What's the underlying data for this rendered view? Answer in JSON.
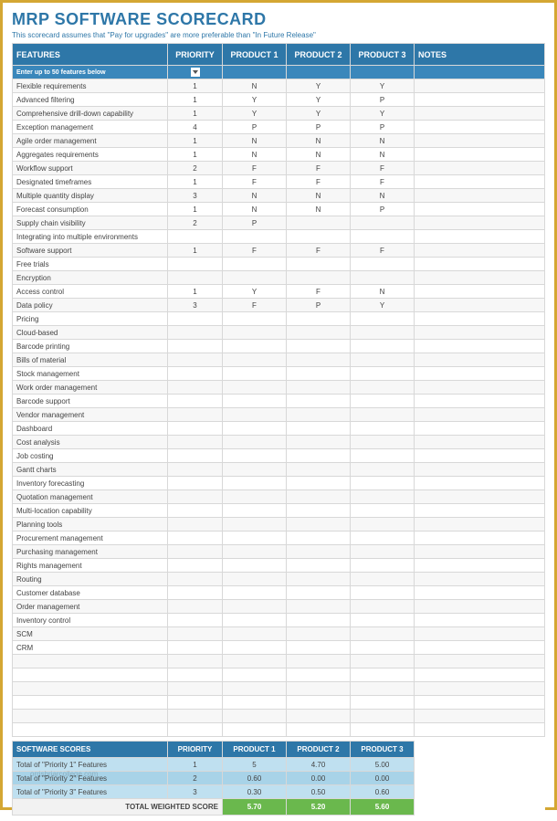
{
  "title": "MRP SOFTWARE SCORECARD",
  "subtitle": "This scorecard assumes that \"Pay for upgrades\" are more preferable than \"In Future Release\"",
  "headers": {
    "features": "FEATURES",
    "priority": "PRIORITY",
    "p1": "PRODUCT 1",
    "p2": "PRODUCT 2",
    "p3": "PRODUCT 3",
    "notes": "NOTES"
  },
  "subhead": "Enter up to 50 features below",
  "rows": [
    {
      "f": "Flexible requirements",
      "prio": "1",
      "p1": "N",
      "p2": "Y",
      "p3": "Y"
    },
    {
      "f": "Advanced filtering",
      "prio": "1",
      "p1": "Y",
      "p2": "Y",
      "p3": "P"
    },
    {
      "f": "Comprehensive drill-down capability",
      "prio": "1",
      "p1": "Y",
      "p2": "Y",
      "p3": "Y"
    },
    {
      "f": "Exception management",
      "prio": "4",
      "p1": "P",
      "p2": "P",
      "p3": "P"
    },
    {
      "f": "Agile order management",
      "prio": "1",
      "p1": "N",
      "p2": "N",
      "p3": "N"
    },
    {
      "f": "Aggregates requirements",
      "prio": "1",
      "p1": "N",
      "p2": "N",
      "p3": "N"
    },
    {
      "f": "Workflow support",
      "prio": "2",
      "p1": "F",
      "p2": "F",
      "p3": "F"
    },
    {
      "f": "Designated timeframes",
      "prio": "1",
      "p1": "F",
      "p2": "F",
      "p3": "F"
    },
    {
      "f": "Multiple quantity display",
      "prio": "3",
      "p1": "N",
      "p2": "N",
      "p3": "N"
    },
    {
      "f": "Forecast consumption",
      "prio": "1",
      "p1": "N",
      "p2": "N",
      "p3": "P"
    },
    {
      "f": "Supply chain visibility",
      "prio": "2",
      "p1": "P",
      "p2": "",
      "p3": ""
    },
    {
      "f": "Integrating into multiple environments",
      "prio": "",
      "p1": "",
      "p2": "",
      "p3": ""
    },
    {
      "f": "Software support",
      "prio": "1",
      "p1": "F",
      "p2": "F",
      "p3": "F"
    },
    {
      "f": "Free trials",
      "prio": "",
      "p1": "",
      "p2": "",
      "p3": ""
    },
    {
      "f": "Encryption",
      "prio": "",
      "p1": "",
      "p2": "",
      "p3": ""
    },
    {
      "f": "Access control",
      "prio": "1",
      "p1": "Y",
      "p2": "F",
      "p3": "N"
    },
    {
      "f": "Data policy",
      "prio": "3",
      "p1": "F",
      "p2": "P",
      "p3": "Y"
    },
    {
      "f": "Pricing",
      "prio": "",
      "p1": "",
      "p2": "",
      "p3": ""
    },
    {
      "f": "Cloud-based",
      "prio": "",
      "p1": "",
      "p2": "",
      "p3": ""
    },
    {
      "f": "Barcode printing",
      "prio": "",
      "p1": "",
      "p2": "",
      "p3": ""
    },
    {
      "f": "Bills of material",
      "prio": "",
      "p1": "",
      "p2": "",
      "p3": ""
    },
    {
      "f": "Stock management",
      "prio": "",
      "p1": "",
      "p2": "",
      "p3": ""
    },
    {
      "f": "Work order management",
      "prio": "",
      "p1": "",
      "p2": "",
      "p3": ""
    },
    {
      "f": "Barcode support",
      "prio": "",
      "p1": "",
      "p2": "",
      "p3": ""
    },
    {
      "f": "Vendor management",
      "prio": "",
      "p1": "",
      "p2": "",
      "p3": ""
    },
    {
      "f": "Dashboard",
      "prio": "",
      "p1": "",
      "p2": "",
      "p3": ""
    },
    {
      "f": "Cost analysis",
      "prio": "",
      "p1": "",
      "p2": "",
      "p3": ""
    },
    {
      "f": "Job costing",
      "prio": "",
      "p1": "",
      "p2": "",
      "p3": ""
    },
    {
      "f": "Gantt charts",
      "prio": "",
      "p1": "",
      "p2": "",
      "p3": ""
    },
    {
      "f": "Inventory forecasting",
      "prio": "",
      "p1": "",
      "p2": "",
      "p3": ""
    },
    {
      "f": "Quotation management",
      "prio": "",
      "p1": "",
      "p2": "",
      "p3": ""
    },
    {
      "f": "Multi-location capability",
      "prio": "",
      "p1": "",
      "p2": "",
      "p3": ""
    },
    {
      "f": "Planning tools",
      "prio": "",
      "p1": "",
      "p2": "",
      "p3": ""
    },
    {
      "f": "Procurement management",
      "prio": "",
      "p1": "",
      "p2": "",
      "p3": ""
    },
    {
      "f": "Purchasing management",
      "prio": "",
      "p1": "",
      "p2": "",
      "p3": ""
    },
    {
      "f": "Rights management",
      "prio": "",
      "p1": "",
      "p2": "",
      "p3": ""
    },
    {
      "f": "Routing",
      "prio": "",
      "p1": "",
      "p2": "",
      "p3": ""
    },
    {
      "f": "Customer database",
      "prio": "",
      "p1": "",
      "p2": "",
      "p3": ""
    },
    {
      "f": "Order management",
      "prio": "",
      "p1": "",
      "p2": "",
      "p3": ""
    },
    {
      "f": "Inventory control",
      "prio": "",
      "p1": "",
      "p2": "",
      "p3": ""
    },
    {
      "f": "SCM",
      "prio": "",
      "p1": "",
      "p2": "",
      "p3": ""
    },
    {
      "f": "CRM",
      "prio": "",
      "p1": "",
      "p2": "",
      "p3": ""
    },
    {
      "f": "",
      "prio": "",
      "p1": "",
      "p2": "",
      "p3": ""
    },
    {
      "f": "",
      "prio": "",
      "p1": "",
      "p2": "",
      "p3": ""
    },
    {
      "f": "",
      "prio": "",
      "p1": "",
      "p2": "",
      "p3": ""
    },
    {
      "f": "",
      "prio": "",
      "p1": "",
      "p2": "",
      "p3": ""
    },
    {
      "f": "",
      "prio": "",
      "p1": "",
      "p2": "",
      "p3": ""
    },
    {
      "f": "",
      "prio": "",
      "p1": "",
      "p2": "",
      "p3": ""
    }
  ],
  "scores": {
    "header": "SOFTWARE SCORES",
    "cols": {
      "priority": "PRIORITY",
      "p1": "PRODUCT 1",
      "p2": "PRODUCT 2",
      "p3": "PRODUCT 3"
    },
    "rows": [
      {
        "label": "Total of \"Priority 1\" Features",
        "prio": "1",
        "p1": "5",
        "p2": "4.70",
        "p3": "5.00"
      },
      {
        "label": "Total of \"Priority 2\" Features",
        "prio": "2",
        "p1": "0.60",
        "p2": "0.00",
        "p3": "0.00"
      },
      {
        "label": "Total of \"Priority 3\" Features",
        "prio": "3",
        "p1": "0.30",
        "p2": "0.50",
        "p3": "0.60"
      }
    ],
    "total_label": "TOTAL WEIGHTED SCORE",
    "totals": {
      "p1": "5.70",
      "p2": "5.20",
      "p3": "5.60"
    }
  },
  "watermark": "orrisbriarcollege.com"
}
